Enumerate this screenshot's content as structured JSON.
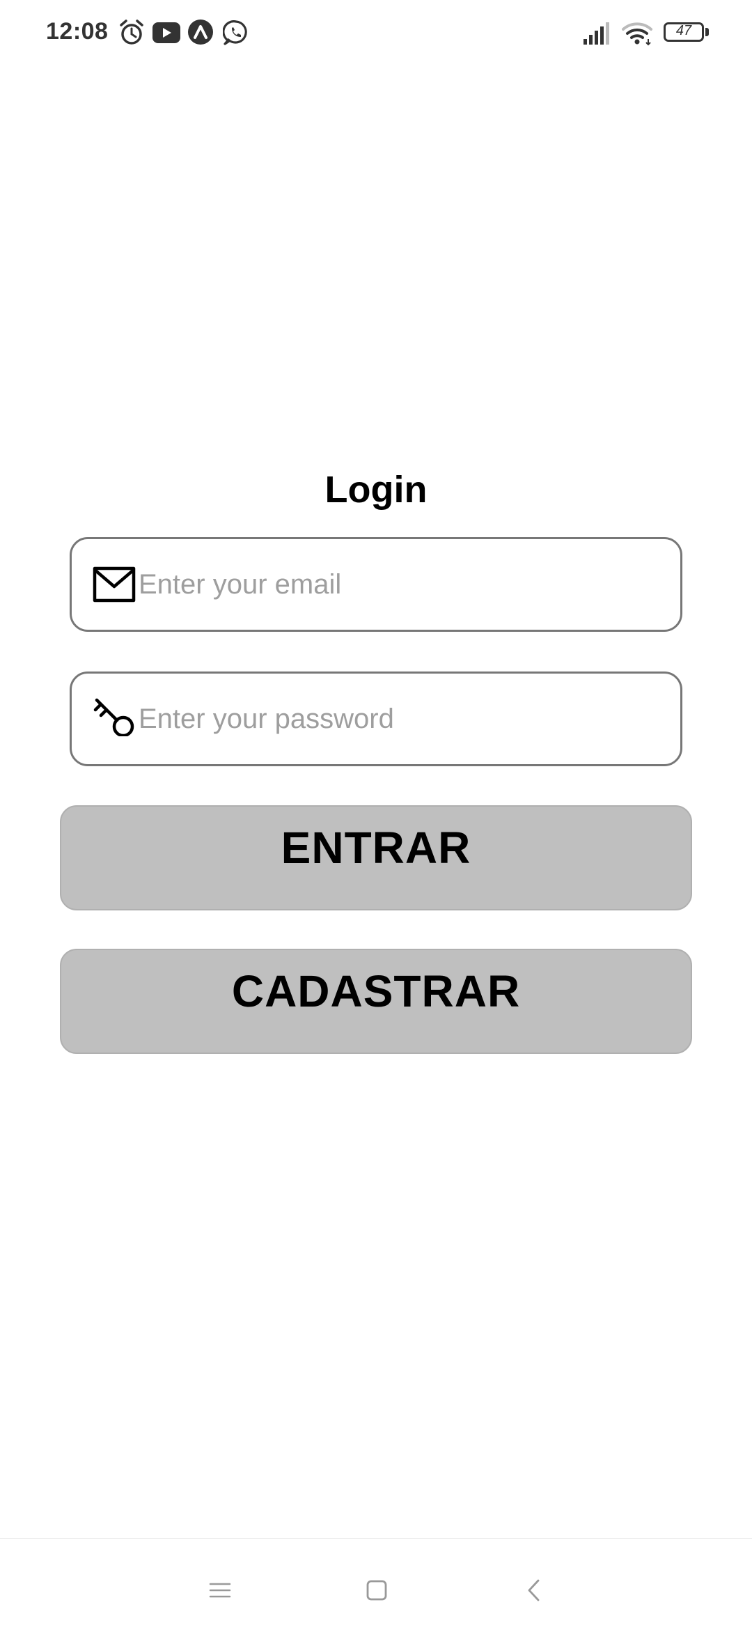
{
  "status_bar": {
    "time": "12:08",
    "notification_icons": [
      "alarm-icon",
      "youtube-icon",
      "arrow-up-circle-icon",
      "whatsapp-icon"
    ],
    "signal_icon": "cell-signal-icon",
    "wifi_icon": "wifi-icon",
    "battery_level": "47"
  },
  "login": {
    "title": "Login",
    "email": {
      "icon": "envelope-icon",
      "placeholder": "Enter your email",
      "value": ""
    },
    "password": {
      "icon": "key-icon",
      "placeholder": "Enter your password",
      "value": ""
    },
    "entrar_label": "ENTRAR",
    "cadastrar_label": "CADASTRAR",
    "button_color": "#bfbfbf",
    "input_border_color": "#777777"
  },
  "nav_bar": {
    "items": [
      "menu-icon",
      "home-square-icon",
      "back-chevron-icon"
    ]
  }
}
